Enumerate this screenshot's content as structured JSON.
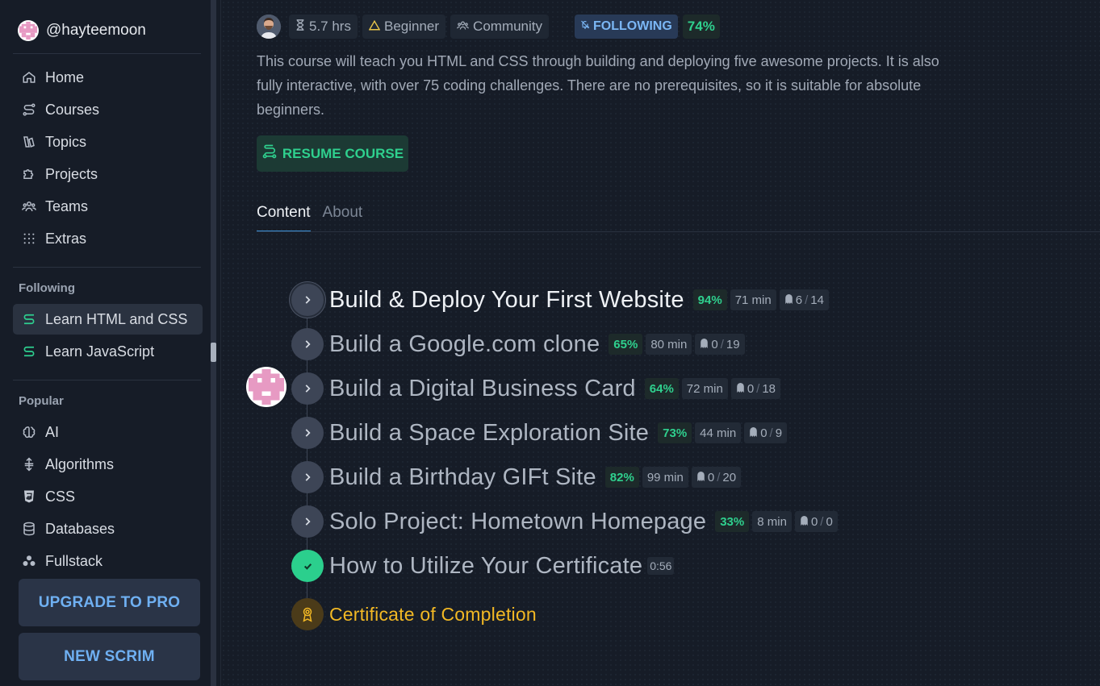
{
  "user": {
    "handle": "@hayteemoon"
  },
  "nav": [
    {
      "label": "Home",
      "icon": "home-icon"
    },
    {
      "label": "Courses",
      "icon": "route-icon"
    },
    {
      "label": "Topics",
      "icon": "book-icon"
    },
    {
      "label": "Projects",
      "icon": "puzzle-icon"
    },
    {
      "label": "Teams",
      "icon": "users-icon"
    },
    {
      "label": "Extras",
      "icon": "grid-dots-icon"
    }
  ],
  "following": {
    "title": "Following",
    "items": [
      {
        "label": "Learn HTML and CSS",
        "icon": "route-icon",
        "active": true
      },
      {
        "label": "Learn JavaScript",
        "icon": "route-icon",
        "active": false
      }
    ]
  },
  "popular": {
    "title": "Popular",
    "items": [
      {
        "label": "AI",
        "icon": "brain-icon"
      },
      {
        "label": "Algorithms",
        "icon": "sort-icon"
      },
      {
        "label": "CSS",
        "icon": "css-icon"
      },
      {
        "label": "Databases",
        "icon": "database-icon"
      },
      {
        "label": "Fullstack",
        "icon": "circles-icon"
      }
    ]
  },
  "buttons": {
    "upgrade": "UPGRADE TO PRO",
    "new_scrim": "NEW SCRIM"
  },
  "course": {
    "hours": "5.7 hrs",
    "level": "Beginner",
    "access": "Community",
    "following_label": "FOLLOWING",
    "progress": "74%",
    "description": "This course will teach you HTML and CSS through building and deploying five awesome projects. It is also fully interactive, with over 75 coding challenges. There are no prerequisites, so it is suitable for absolute beginners.",
    "resume_label": "RESUME COURSE"
  },
  "tabs": [
    {
      "label": "Content",
      "active": true
    },
    {
      "label": "About",
      "active": false
    }
  ],
  "lessons": [
    {
      "title": "Build & Deploy Your First Website",
      "pct": "94%",
      "minutes": "71 min",
      "done": "6",
      "total": "14"
    },
    {
      "title": "Build a Google.com clone",
      "pct": "65%",
      "minutes": "80 min",
      "done": "0",
      "total": "19"
    },
    {
      "title": "Build a Digital Business Card",
      "pct": "64%",
      "minutes": "72 min",
      "done": "0",
      "total": "18"
    },
    {
      "title": "Build a Space Exploration Site",
      "pct": "73%",
      "minutes": "44 min",
      "done": "0",
      "total": "9"
    },
    {
      "title": "Build a Birthday GIFt Site",
      "pct": "82%",
      "minutes": "99 min",
      "done": "0",
      "total": "20"
    },
    {
      "title": "Solo Project: Hometown Homepage",
      "pct": "33%",
      "minutes": "8 min",
      "done": "0",
      "total": "0"
    }
  ],
  "extra_lesson": {
    "title": "How to Utilize Your Certificate",
    "duration": "0:56"
  },
  "certificate": {
    "title": "Certificate of Completion"
  },
  "colors": {
    "accent_green": "#2fd08e",
    "accent_blue": "#6fb0f2",
    "cert_gold": "#f2b824",
    "bg": "#161c27"
  }
}
